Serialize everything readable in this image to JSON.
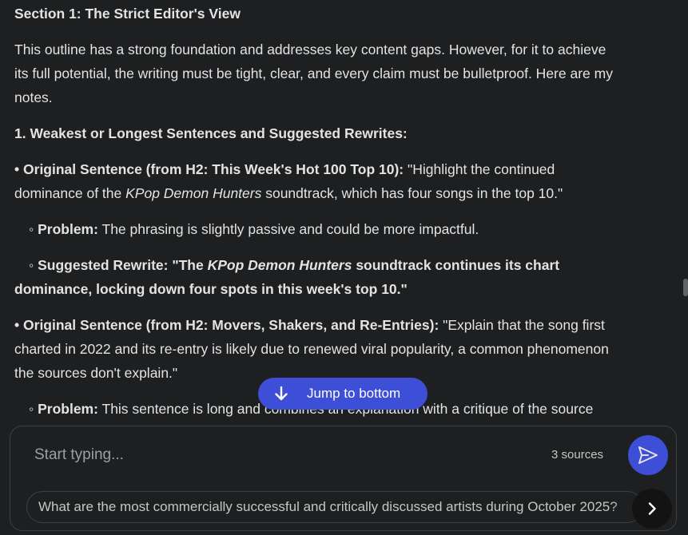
{
  "document": {
    "heading": "Section 1: The Strict Editor's View",
    "intro_1": "This outline has a strong foundation and addresses key content gaps. However, for it to achieve",
    "intro_2": "its full potential, the writing must be tight, clear, and every claim must be bulletproof. Here are my",
    "intro_3": "notes.",
    "subheading": "1. Weakest or Longest Sentences and Suggested Rewrites:",
    "item1": {
      "bullet": "•",
      "label": "Original Sentence (from H2: This Week's Hot 100 Top 10):",
      "quote_1": "\"Highlight the continued",
      "line2_a": "dominance of the ",
      "line2_italic": "KPop Demon Hunters",
      "line2_b": " soundtrack, which has four songs in the top 10.\"",
      "problem_bullet": "◦",
      "problem_label": "Problem:",
      "problem_text": "The phrasing is slightly passive and could be more impactful.",
      "rewrite_bullet": "◦",
      "rewrite_label": "Suggested Rewrite: \"The ",
      "rewrite_italic": "KPop Demon Hunters",
      "rewrite_rest": " soundtrack continues its chart",
      "rewrite_line2": "dominance, locking down four spots in this week's top 10.\""
    },
    "item2": {
      "bullet": "•",
      "label": "Original Sentence (from H2: Movers, Shakers, and Re-Entries):",
      "quote_1": "\"Explain that the song first",
      "line2": "charted in 2022 and its re-entry is likely due to renewed viral popularity, a common phenomenon",
      "line3": "the sources don't explain.\"",
      "problem_bullet": "◦",
      "problem_label": "Problem:",
      "problem_text": "This sentence is long and combines an explanation with a critique of the source"
    }
  },
  "jump_button": {
    "label": "Jump to bottom",
    "icon": "arrow-down-icon"
  },
  "composer": {
    "placeholder": "Start typing...",
    "sources_label": "3 sources",
    "send_icon": "send-icon",
    "suggestion": "What are the most commercially successful and critically discussed artists during October 2025?",
    "next_icon": "chevron-right-icon"
  },
  "colors": {
    "background": "#1e1f20",
    "text": "#e3e3e3",
    "accent": "#3d4fd6",
    "border": "#3c4043"
  }
}
